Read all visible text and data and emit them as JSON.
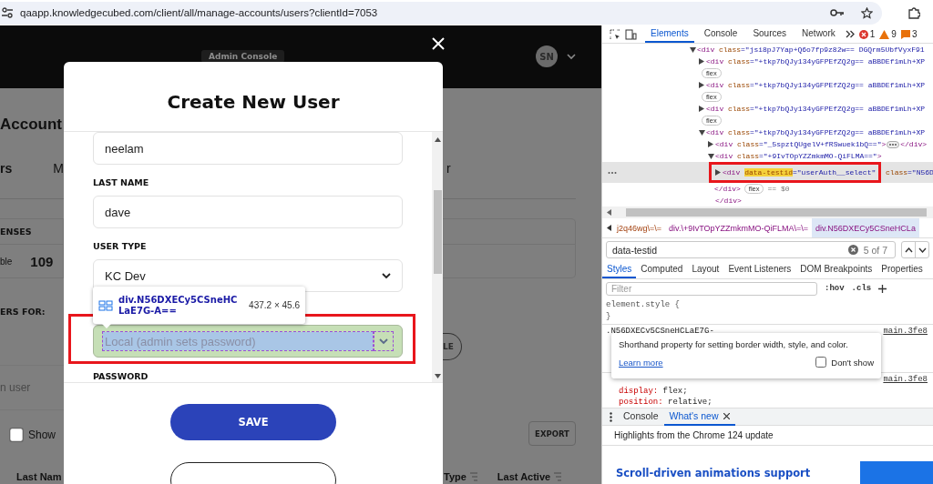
{
  "browser": {
    "url": "qaapp.knowledgecubed.com/client/all/manage-accounts/users?clientId=7053"
  },
  "app": {
    "header": {
      "badge": "Admin Console",
      "avatar": "SN"
    },
    "background": {
      "title": "Account",
      "tabs": [
        {
          "label": "rs",
          "selected": true
        },
        {
          "label": "M",
          "selected": false
        },
        {
          "label": "r",
          "selected": false
        }
      ],
      "panel_label": "ENSES",
      "stat_label": "ble",
      "stat_value": "109",
      "filter_label": "ERS FOR:",
      "filter_button": "LE",
      "search_placeholder": "n user",
      "checkbox": {
        "label": "Show",
        "checked": false
      },
      "export": "EXPORT",
      "columns": [
        "Last Nam",
        "Type",
        "Last Active"
      ]
    },
    "modal": {
      "title": "Create New User",
      "fields": [
        {
          "kind": "input",
          "value": "neelam"
        },
        {
          "kind": "input",
          "label": "LAST NAME",
          "value": "dave"
        },
        {
          "kind": "select",
          "label": "USER TYPE",
          "value": "KC Dev",
          "inspected": false
        },
        {
          "kind": "select",
          "value": "Local (admin sets password)",
          "inspected": true
        },
        {
          "kind": "heading",
          "label": "PASSWORD"
        }
      ],
      "inspect_tooltip": {
        "selector": "div.N56DXECy5CSneHCLaE7G-A==",
        "size": "437.2 × 45.6"
      },
      "buttons": [
        {
          "kind": "primary",
          "label": "SAVE"
        },
        {
          "kind": "outline"
        }
      ]
    }
  },
  "devtools": {
    "tabs": [
      {
        "label": "Elements",
        "selected": true
      },
      {
        "label": "Console",
        "selected": false
      },
      {
        "label": "Sources",
        "selected": false
      },
      {
        "label": "Network",
        "selected": false
      }
    ],
    "issues": [
      {
        "kind": "error",
        "count": "1"
      },
      {
        "kind": "warning",
        "count": "9"
      },
      {
        "kind": "info",
        "count": "3"
      }
    ],
    "dom_tree": [
      {
        "expanded": true,
        "selected": false,
        "segments": [
          {
            "kind": "tag",
            "text": "<div"
          },
          {
            "kind": "attr",
            "text": " class"
          },
          {
            "kind": "value",
            "text": "=\"jsi8pJ7Yap+Q6o7fp9z82w== DGQrm5UbfVyxF91"
          }
        ],
        "children": [
          {
            "expanded": false,
            "selected": false,
            "badge": "flex",
            "segments": [
              {
                "kind": "tag",
                "text": "<div"
              },
              {
                "kind": "attr",
                "text": " class"
              },
              {
                "kind": "value",
                "text": "=\"+tkp7bQJy134yGFPEfZQ2g== aBBDEf1mLh+XP"
              }
            ]
          },
          {
            "expanded": false,
            "selected": false,
            "badge": "flex",
            "segments": [
              {
                "kind": "tag",
                "text": "<div"
              },
              {
                "kind": "attr",
                "text": " class"
              },
              {
                "kind": "value",
                "text": "=\"+tkp7bQJy134yGFPEfZQ2g== aBBDEf1mLh+XP"
              }
            ]
          },
          {
            "expanded": false,
            "selected": false,
            "badge": "flex",
            "segments": [
              {
                "kind": "tag",
                "text": "<div"
              },
              {
                "kind": "attr",
                "text": " class"
              },
              {
                "kind": "value",
                "text": "=\"+tkp7bQJy134yGFPEfZQ2g== aBBDEf1mLh+XP"
              }
            ]
          },
          {
            "expanded": true,
            "selected": false,
            "segments": [
              {
                "kind": "tag",
                "text": "<div"
              },
              {
                "kind": "attr",
                "text": " class"
              },
              {
                "kind": "value",
                "text": "=\"+tkp7bQJy134yGFPEfZQ2g== aBBDEf1mLh+XP"
              }
            ],
            "children": [
              {
                "expanded": false,
                "selected": false,
                "ellipsis": true,
                "segments": [
                  {
                    "kind": "tag",
                    "text": "<div"
                  },
                  {
                    "kind": "attr",
                    "text": " class"
                  },
                  {
                    "kind": "value",
                    "text": "=\"_5spztQUgelV+fRSwuek1bQ==\""
                  },
                  {
                    "kind": "tag",
                    "text": ">"
                  }
                ],
                "after": [
                  {
                    "kind": "tag",
                    "text": "</div>"
                  }
                ]
              },
              {
                "expanded": true,
                "selected": false,
                "segments": [
                  {
                    "kind": "tag",
                    "text": "<div"
                  },
                  {
                    "kind": "attr",
                    "text": " class"
                  },
                  {
                    "kind": "value",
                    "text": "=\"+9IvTOpYZZmkmMO-QiFLMA==\""
                  },
                  {
                    "kind": "tag",
                    "text": ">"
                  }
                ],
                "children": [
                  {
                    "expanded": false,
                    "selected": true,
                    "annotated": true,
                    "segments": [
                      {
                        "kind": "tag",
                        "text": "<div"
                      },
                      {
                        "kind": "match",
                        "text": "data-testid"
                      },
                      {
                        "kind": "value",
                        "text": "=\"userAuth__select\""
                      }
                    ],
                    "trailing": [
                      {
                        "kind": "attr",
                        "text": " class"
                      },
                      {
                        "kind": "value",
                        "text": "=\"N56D"
                      }
                    ],
                    "after_line": [
                      {
                        "kind": "tag",
                        "text": "</div>"
                      }
                    ],
                    "badge": "flex",
                    "marker": "== $0"
                  }
                ],
                "close": "</div>"
              }
            ]
          }
        ]
      }
    ],
    "breadcrumbs": [
      {
        "label": "j2q46wg\\=\\=",
        "selected": false
      },
      {
        "label": "div.\\+9IvTOpYZZmkmMO-QiFLMA\\=\\=",
        "selected": false
      },
      {
        "label": "div.N56DXECy5CSneHCLa",
        "selected": true
      }
    ],
    "search": {
      "value": "data-testid",
      "count": "5 of 7"
    },
    "styles_tabs": [
      {
        "label": "Styles",
        "selected": true
      },
      {
        "label": "Computed",
        "selected": false
      },
      {
        "label": "Layout",
        "selected": false
      },
      {
        "label": "Event Listeners",
        "selected": false
      },
      {
        "label": "DOM Breakpoints",
        "selected": false
      },
      {
        "label": "Properties",
        "selected": false
      }
    ],
    "filter": {
      "placeholder": "Filter",
      "hov": ":hov",
      "cls": ".cls"
    },
    "element_style": {
      "open": "element.style {",
      "close": "}"
    },
    "rules": [
      {
        "selector": ".N56DXECy5CSneHCLaE7G-",
        "source": "main.3fe8"
      },
      {
        "source": "main.3fe8",
        "declarations": [
          {
            "property": "display:",
            "value": " flex;"
          },
          {
            "property": "position:",
            "value": " relative;"
          }
        ]
      }
    ],
    "css_tooltip": {
      "text": "Shorthand property for setting border width, style, and color.",
      "link": "Learn more",
      "checkbox": {
        "label": "Don't show",
        "checked": false
      }
    },
    "drawer": {
      "tabs": [
        {
          "label": "Console",
          "selected": false,
          "closable": false
        },
        {
          "label": "What's new",
          "selected": true,
          "closable": true
        }
      ],
      "subtitle": "Highlights from the Chrome 124 update",
      "feature": "Scroll-driven animations support"
    }
  }
}
